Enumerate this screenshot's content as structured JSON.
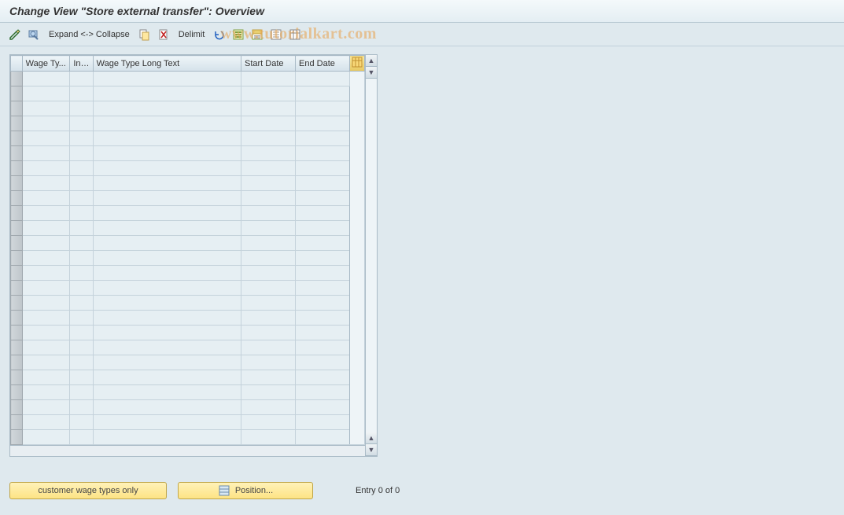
{
  "title": "Change View \"Store external transfer\": Overview",
  "toolbar": {
    "expand_collapse": "Expand <-> Collapse",
    "delimit": "Delimit"
  },
  "table": {
    "headers": {
      "wage_type": "Wage Ty...",
      "inf": "Inf...",
      "long_text": "Wage Type Long Text",
      "start_date": "Start Date",
      "end_date": "End Date"
    },
    "row_count": 25
  },
  "buttons": {
    "customer": "customer wage types only",
    "position": "Position..."
  },
  "status": {
    "entry": "Entry 0 of 0"
  },
  "watermark": "www.tutorialkart.com"
}
